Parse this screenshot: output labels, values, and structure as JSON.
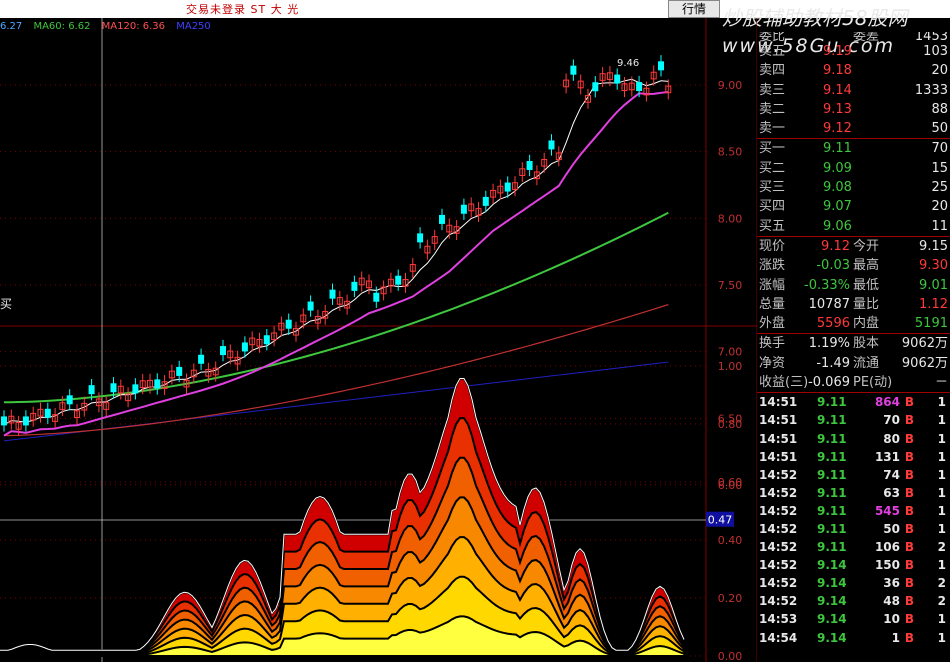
{
  "header": {
    "title": "交易未登录  ST 大 光",
    "trade_button": "行情"
  },
  "watermark": {
    "line1": "炒股辅助教材58股网",
    "line2": "www.58Gu.com"
  },
  "ma_legend": [
    {
      "label": "6.27",
      "color": "#4fa8ff"
    },
    {
      "label": "MA60: 6.62",
      "color": "#3ec63e"
    },
    {
      "label": "MA120: 6.36",
      "color": "#ff5050"
    },
    {
      "label": "MA250",
      "color": "#3030ff"
    }
  ],
  "price_axis": {
    "labels": [
      "9.00",
      "8.50",
      "8.00",
      "7.50",
      "7.00",
      "6.50",
      "6.00"
    ]
  },
  "lower_axis": {
    "labels": [
      "1.00",
      "0.80",
      "0.60",
      "0.40",
      "0.20",
      "0.00"
    ],
    "marker": "0.47"
  },
  "annotations": {
    "peak_price": "9.46",
    "buy_signal": "买"
  },
  "top_partial": {
    "left": "委比",
    "right": "委差",
    "value": "1453"
  },
  "order_book": {
    "asks": [
      {
        "label": "卖五",
        "price": "9.19",
        "volume": "103"
      },
      {
        "label": "卖四",
        "price": "9.18",
        "volume": "20"
      },
      {
        "label": "卖三",
        "price": "9.14",
        "volume": "1333"
      },
      {
        "label": "卖二",
        "price": "9.13",
        "volume": "88"
      },
      {
        "label": "卖一",
        "price": "9.12",
        "volume": "50"
      }
    ],
    "bids": [
      {
        "label": "买一",
        "price": "9.11",
        "volume": "70"
      },
      {
        "label": "买二",
        "price": "9.09",
        "volume": "15"
      },
      {
        "label": "买三",
        "price": "9.08",
        "volume": "25"
      },
      {
        "label": "买四",
        "price": "9.07",
        "volume": "20"
      },
      {
        "label": "买五",
        "price": "9.06",
        "volume": "11"
      }
    ]
  },
  "quote": [
    {
      "k1": "现价",
      "v1": "9.12",
      "k2": "今开",
      "v2": "9.15",
      "c1": "red",
      "c2": "white"
    },
    {
      "k1": "涨跌",
      "v1": "-0.03",
      "k2": "最高",
      "v2": "9.30",
      "c1": "green",
      "c2": "red"
    },
    {
      "k1": "涨幅",
      "v1": "-0.33%",
      "k2": "最低",
      "v2": "9.01",
      "c1": "green",
      "c2": "green"
    },
    {
      "k1": "总量",
      "v1": "10787",
      "k2": "量比",
      "v2": "1.12",
      "c1": "white",
      "c2": "red"
    },
    {
      "k1": "外盘",
      "v1": "5596",
      "k2": "内盘",
      "v2": "5191",
      "c1": "red",
      "c2": "green"
    }
  ],
  "fundamentals": [
    {
      "k1": "换手",
      "v1": "1.19%",
      "k2": "股本",
      "v2": "9062万"
    },
    {
      "k1": "净资",
      "v1": "-1.49",
      "k2": "流通",
      "v2": "9062万"
    },
    {
      "k1": "收益(三)",
      "v1": "-0.069",
      "k2": "PE(动)",
      "v2": "－"
    }
  ],
  "ticks": [
    {
      "time": "14:51",
      "price": "9.11",
      "vol": "864",
      "side": "B",
      "num": "1",
      "hi": true
    },
    {
      "time": "14:51",
      "price": "9.11",
      "vol": "70",
      "side": "B",
      "num": "1"
    },
    {
      "time": "14:51",
      "price": "9.11",
      "vol": "80",
      "side": "B",
      "num": "1"
    },
    {
      "time": "14:51",
      "price": "9.11",
      "vol": "131",
      "side": "B",
      "num": "1"
    },
    {
      "time": "14:52",
      "price": "9.11",
      "vol": "74",
      "side": "B",
      "num": "1"
    },
    {
      "time": "14:52",
      "price": "9.11",
      "vol": "63",
      "side": "B",
      "num": "1"
    },
    {
      "time": "14:52",
      "price": "9.11",
      "vol": "545",
      "side": "B",
      "num": "1",
      "hi": true
    },
    {
      "time": "14:52",
      "price": "9.11",
      "vol": "50",
      "side": "B",
      "num": "1"
    },
    {
      "time": "14:52",
      "price": "9.11",
      "vol": "106",
      "side": "B",
      "num": "2"
    },
    {
      "time": "14:52",
      "price": "9.14",
      "vol": "150",
      "side": "B",
      "num": "1"
    },
    {
      "time": "14:52",
      "price": "9.14",
      "vol": "36",
      "side": "B",
      "num": "2"
    },
    {
      "time": "14:52",
      "price": "9.14",
      "vol": "48",
      "side": "B",
      "num": "2"
    },
    {
      "time": "14:53",
      "price": "9.14",
      "vol": "10",
      "side": "B",
      "num": "1"
    },
    {
      "time": "14:54",
      "price": "9.14",
      "vol": "1",
      "side": "B",
      "num": "1"
    }
  ],
  "colors": {
    "up": "#ff3a3a",
    "down": "#00ffff",
    "ma5": "#ffffff",
    "ma10": "#e040e0",
    "ma60": "#3ec63e",
    "ma120": "#c03030",
    "ma250": "#2020c0",
    "grid": "#800000"
  }
}
